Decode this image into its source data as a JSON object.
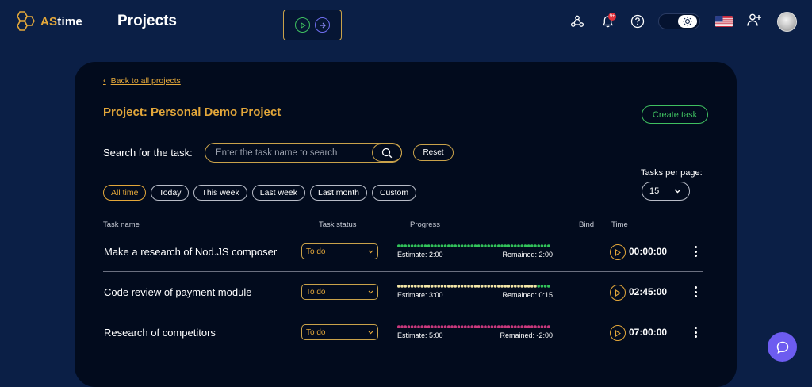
{
  "app": {
    "logo_prefix": "AS",
    "logo_suffix": "time",
    "page_title": "Projects"
  },
  "header": {
    "notification_count": "9+",
    "flag": "us-flag-icon",
    "icons": [
      "team-icon",
      "bell-icon",
      "help-icon",
      "theme-toggle",
      "us-flag-icon",
      "add-user-icon",
      "avatar"
    ]
  },
  "project": {
    "back_label": "Back to all projects",
    "title": "Project: Personal Demo Project",
    "create_task_label": "Create task"
  },
  "search": {
    "label": "Search for the task:",
    "placeholder": "Enter the task name to search",
    "reset_label": "Reset"
  },
  "filters": [
    {
      "label": "All time",
      "active": true
    },
    {
      "label": "Today",
      "active": false
    },
    {
      "label": "This week",
      "active": false
    },
    {
      "label": "Last week",
      "active": false
    },
    {
      "label": "Last month",
      "active": false
    },
    {
      "label": "Custom",
      "active": false
    }
  ],
  "tasks_per_page": {
    "label": "Tasks per page:",
    "value": "15"
  },
  "table": {
    "headers": {
      "task_name": "Task name",
      "task_status": "Task status",
      "progress": "Progress",
      "bind": "Bind",
      "time": "Time"
    },
    "rows": [
      {
        "name": "Make a research of Nod.JS composer",
        "status": "To do",
        "estimate": "Estimate: 2:00",
        "remained": "Remained: 2:00",
        "progress_fraction": 0.0,
        "progress_color": "#32c35a",
        "time": "00:00:00"
      },
      {
        "name": "Code review of payment module",
        "status": "To do",
        "estimate": "Estimate: 3:00",
        "remained": "Remained: 0:15",
        "progress_fraction": 0.92,
        "progress_color": "#f3e6a6",
        "time": "02:45:00"
      },
      {
        "name": "Research of competitors",
        "status": "To do",
        "estimate": "Estimate: 5:00",
        "remained": "Remained: -2:00",
        "progress_fraction": 1.0,
        "progress_color": "#c9387c",
        "time": "07:00:00"
      }
    ]
  },
  "colors": {
    "background": "#0b1f46",
    "panel": "#020b1d",
    "accent": "#e3a73a",
    "success": "#3fc060",
    "fab": "#6d5cf0"
  }
}
